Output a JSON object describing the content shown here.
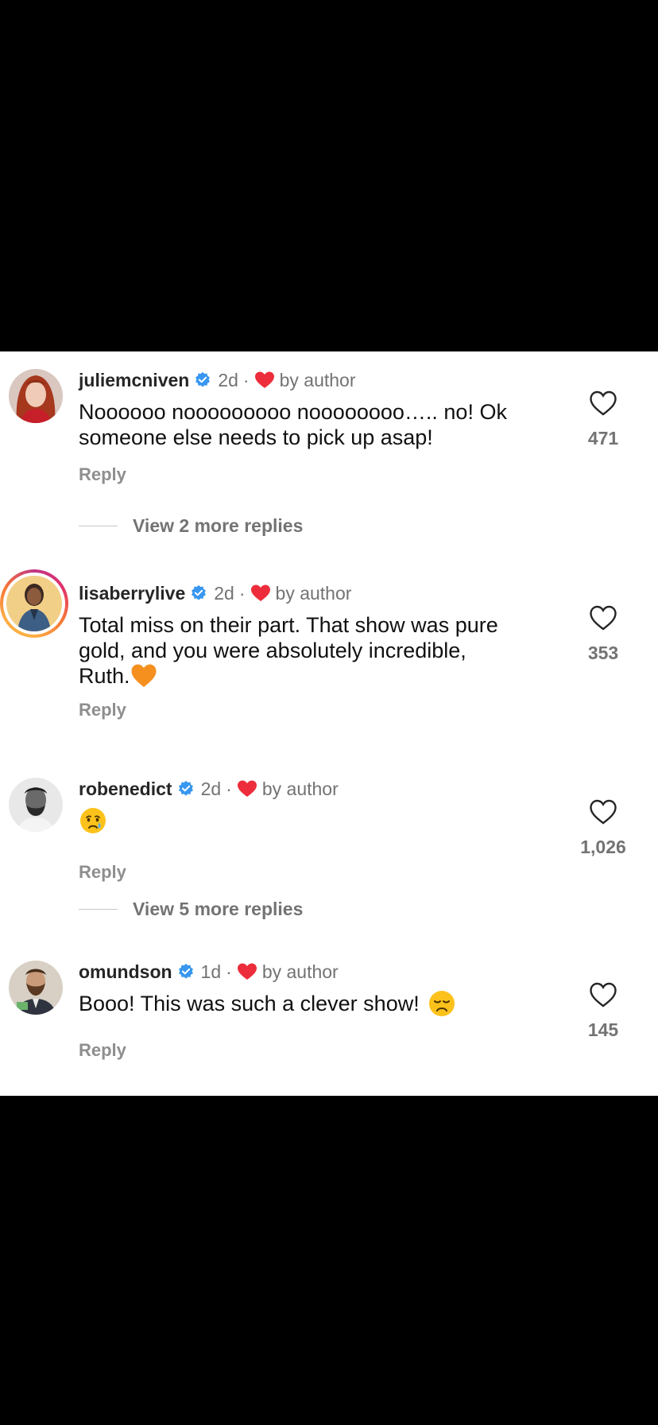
{
  "comments": [
    {
      "username": "juliemcniven",
      "time": "2d",
      "dot": "·",
      "liked_by": "by author",
      "text_lines": [
        "Noooooo nooooooooo noooooooo….. no!  Ok",
        "someone else needs to pick up asap!"
      ],
      "reply_label": "Reply",
      "likes": "471",
      "view_more": "View 2 more replies",
      "avatar_icon": "avatar-red-hair"
    },
    {
      "username": "lisaberrylive",
      "time": "2d",
      "dot": "·",
      "liked_by": "by author",
      "text_lines": [
        "Total miss on their part. That show was pure",
        "gold, and you were absolutely incredible,",
        "Ruth."
      ],
      "text_emoji": "orange-heart-icon",
      "reply_label": "Reply",
      "likes": "353",
      "avatar_icon": "avatar-story-ring"
    },
    {
      "username": "robenedict",
      "time": "2d",
      "dot": "·",
      "liked_by": "by author",
      "text_emoji": "crying-face-icon",
      "reply_label": "Reply",
      "likes": "1,026",
      "view_more": "View 5 more replies",
      "avatar_icon": "avatar-bw"
    },
    {
      "username": "omundson",
      "time": "1d",
      "dot": "·",
      "liked_by": "by author",
      "text_lines": [
        "Booo! This was such a clever show!"
      ],
      "text_emoji": "disappointed-face-icon",
      "reply_label": "Reply",
      "likes": "145",
      "avatar_icon": "avatar-man-beard"
    }
  ],
  "colors": {
    "verified": "#3897f0",
    "heart_red": "#ed2d3b",
    "muted_text": "#737373",
    "reply_text": "#8e8e8e"
  }
}
